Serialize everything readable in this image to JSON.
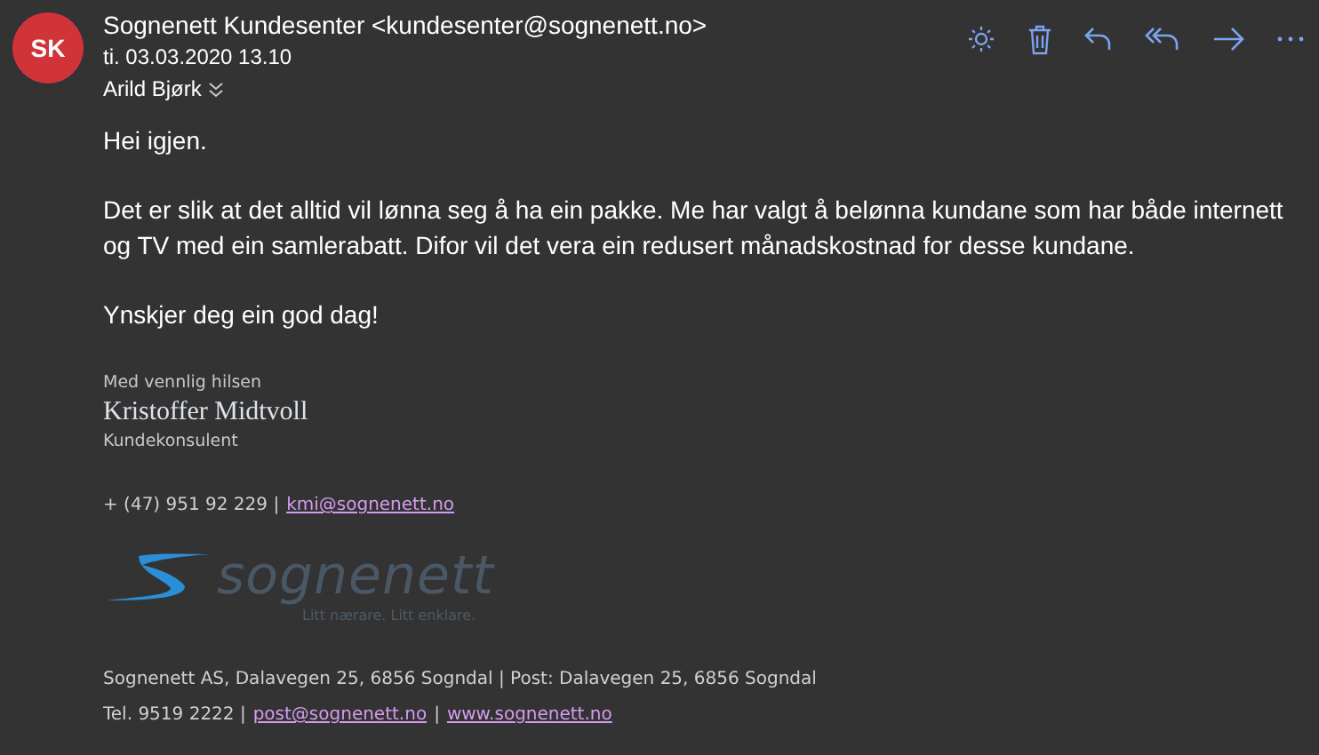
{
  "header": {
    "avatar_initials": "SK",
    "sender": "Sognenett Kundesenter <kundesenter@sognenett.no>",
    "date": "ti. 03.03.2020 13.10",
    "recipient": "Arild Bjørk"
  },
  "body": [
    "Hei igjen.",
    "Det er slik at det alltid vil lønna seg å ha ein pakke. Me har valgt å belønna kundane som har både internett og TV med ein samlerabatt. Difor vil det vera ein redusert månadskostnad for desse kundane.",
    "Ynskjer deg ein god dag!"
  ],
  "signature": {
    "greeting": "Med vennlig hilsen",
    "name": "Kristoffer Midtvoll",
    "title": "Kundekonsulent",
    "phone": "+ (47) 951 92 229 |",
    "email": "kmi@sognenett.no"
  },
  "logo": {
    "name": "sognenett",
    "tagline": "Litt nærare. Litt enklare."
  },
  "footer": {
    "address": "Sognenett AS, Dalavegen 25, 6856 Sogndal | Post: Dalavegen 25, 6856 Sogndal",
    "tel": "Tel. 9519 2222 |",
    "email": "post@sognenett.no",
    "separator": "|",
    "website": "www.sognenett.no"
  }
}
